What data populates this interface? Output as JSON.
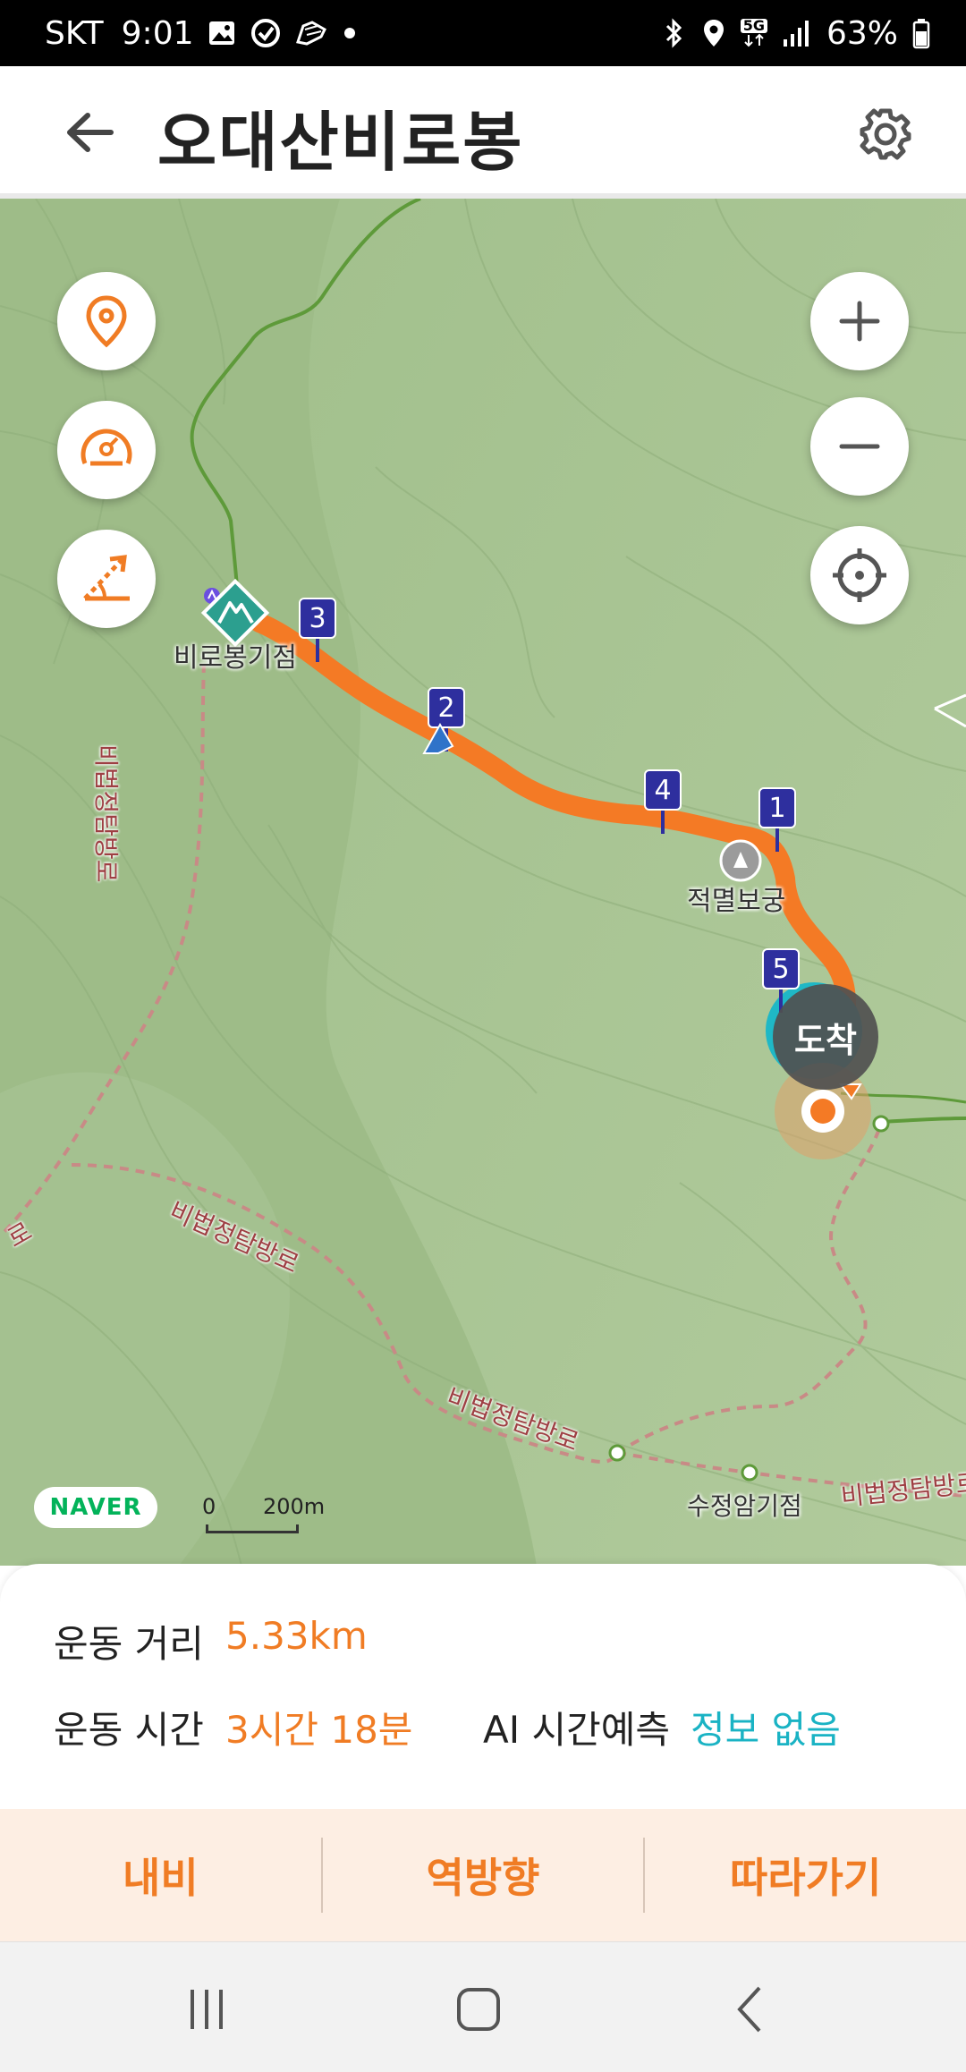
{
  "status_bar": {
    "carrier": "SKT",
    "time": "9:01",
    "network": "5G",
    "battery": "63%",
    "left_icons": [
      "gallery-icon",
      "sync-icon",
      "shoe-icon",
      "dot-icon"
    ],
    "right_icons": [
      "bluetooth-icon",
      "location-icon",
      "5g-icon",
      "signal-icon",
      "battery-icon"
    ]
  },
  "header": {
    "title": "오대산비로봉"
  },
  "map": {
    "peak_label": "비로봉기점",
    "temple_label": "적멸보궁",
    "spring_label": "수정암기점",
    "arrival_label": "도착",
    "trail_labels": [
      "비법정탐방로",
      "비법정탐방로",
      "비법정탐방로",
      "비법정탐방로",
      "로"
    ],
    "waypoints": [
      "1",
      "2",
      "3",
      "4",
      "5"
    ],
    "naver_badge": "NAVER",
    "scale_zero": "0",
    "scale_distance": "200m",
    "route_color": "#f47a25",
    "trail_color": "#5e9a3a"
  },
  "stats": {
    "distance_label": "운동 거리",
    "distance_value": "5.33km",
    "time_label": "운동 시간",
    "time_value": "3시간 18분",
    "ai_label": "AI 시간예측",
    "ai_value": "정보 없음"
  },
  "actions": {
    "navi": "내비",
    "reverse": "역방향",
    "follow": "따라가기"
  },
  "colors": {
    "accent": "#f07c24",
    "ai_accent": "#1ab3c4",
    "action_bg": "#fdeee3"
  }
}
